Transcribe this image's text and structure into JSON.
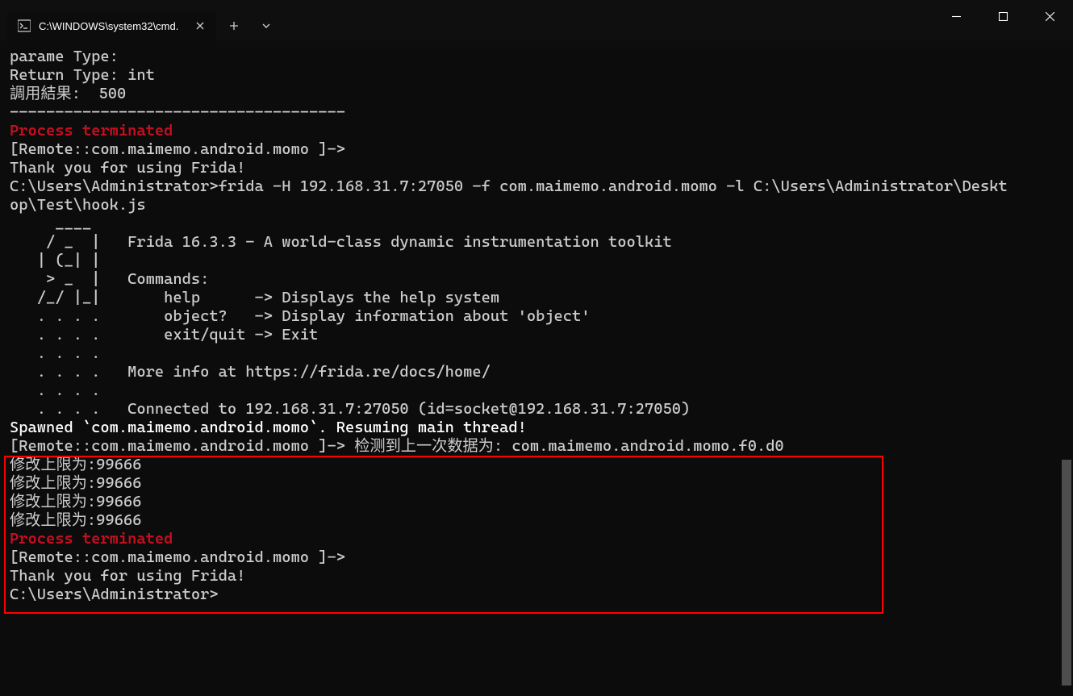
{
  "window": {
    "tab_title": "C:\\WINDOWS\\system32\\cmd."
  },
  "terminal": {
    "lines": [
      {
        "cls": "",
        "text": "parame Type:"
      },
      {
        "cls": "",
        "text": "Return Type: int"
      },
      {
        "cls": "",
        "text": "調用結果:  500"
      },
      {
        "cls": "",
        "text": "-------------------------------------"
      },
      {
        "cls": "red",
        "text": "Process terminated"
      },
      {
        "cls": "",
        "text": "[Remote::com.maimemo.android.momo ]->"
      },
      {
        "cls": "",
        "text": ""
      },
      {
        "cls": "",
        "text": "Thank you for using Frida!"
      },
      {
        "cls": "",
        "text": ""
      },
      {
        "cls": "",
        "text": "C:\\Users\\Administrator>frida -H 192.168.31.7:27050 -f com.maimemo.android.momo -l C:\\Users\\Administrator\\Desktop\\Test\\hook.js"
      },
      {
        "cls": "",
        "text": "     ____"
      },
      {
        "cls": "",
        "text": "    / _  |   Frida 16.3.3 - A world-class dynamic instrumentation toolkit"
      },
      {
        "cls": "",
        "text": "   | (_| |"
      },
      {
        "cls": "",
        "text": "    > _  |   Commands:"
      },
      {
        "cls": "",
        "text": "   /_/ |_|       help      -> Displays the help system"
      },
      {
        "cls": "",
        "text": "   . . . .       object?   -> Display information about 'object'"
      },
      {
        "cls": "",
        "text": "   . . . .       exit/quit -> Exit"
      },
      {
        "cls": "",
        "text": "   . . . ."
      },
      {
        "cls": "",
        "text": "   . . . .   More info at https://frida.re/docs/home/"
      },
      {
        "cls": "",
        "text": "   . . . ."
      },
      {
        "cls": "",
        "text": "   . . . .   Connected to 192.168.31.7:27050 (id=socket@192.168.31.7:27050)"
      },
      {
        "cls": "white",
        "text": "Spawned `com.maimemo.android.momo`. Resuming main thread!"
      },
      {
        "cls": "",
        "text": "[Remote::com.maimemo.android.momo ]-> 检测到上一次数据为: com.maimemo.android.momo.f0.d0"
      },
      {
        "cls": "",
        "text": "修改上限为:99666"
      },
      {
        "cls": "",
        "text": "修改上限为:99666"
      },
      {
        "cls": "",
        "text": "修改上限为:99666"
      },
      {
        "cls": "",
        "text": "修改上限为:99666"
      },
      {
        "cls": "red",
        "text": "Process terminated"
      },
      {
        "cls": "",
        "text": "[Remote::com.maimemo.android.momo ]->"
      },
      {
        "cls": "",
        "text": ""
      },
      {
        "cls": "",
        "text": "Thank you for using Frida!"
      },
      {
        "cls": "",
        "text": ""
      }
    ],
    "prompt": "C:\\Users\\Administrator>"
  }
}
